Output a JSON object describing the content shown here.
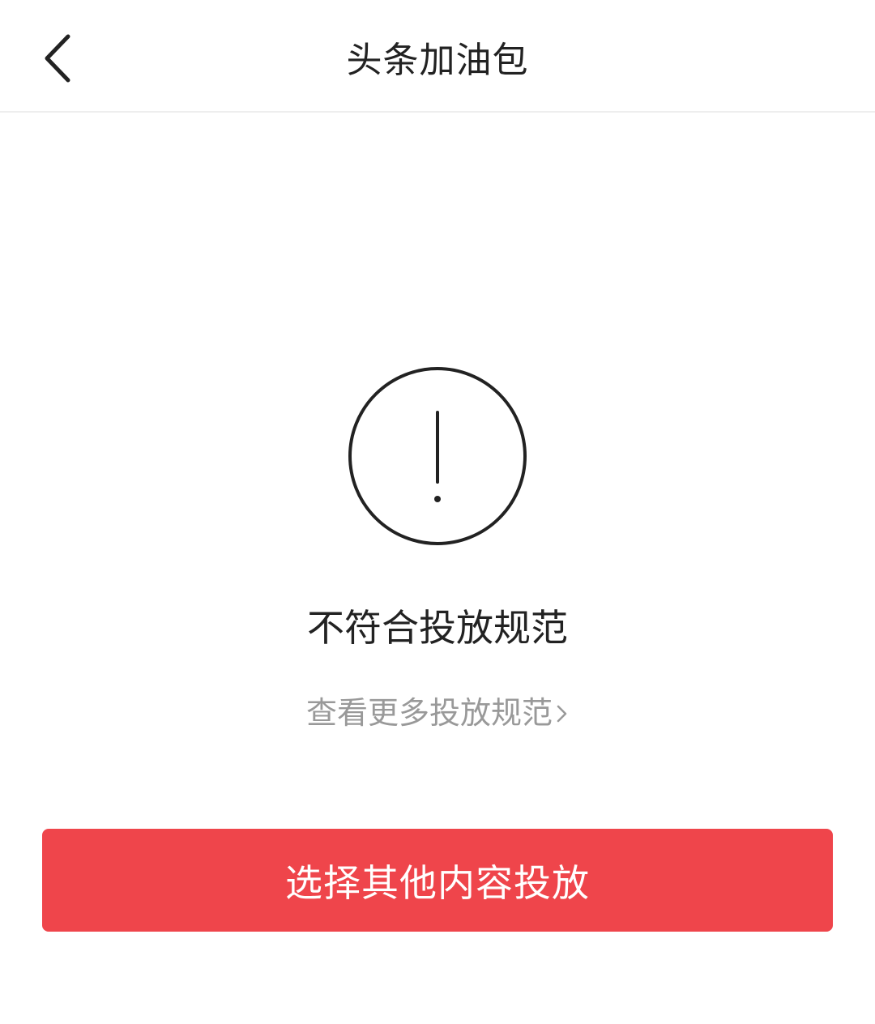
{
  "header": {
    "title": "头条加油包",
    "back_icon": "chevron-left-icon"
  },
  "status": {
    "icon": "exclamation-circle-icon",
    "title": "不符合投放规范",
    "link_label": "查看更多投放规范",
    "link_icon": "chevron-right-icon"
  },
  "actions": {
    "primary_label": "选择其他内容投放"
  },
  "colors": {
    "accent": "#ef454b",
    "text": "#222222",
    "muted": "#999999"
  }
}
